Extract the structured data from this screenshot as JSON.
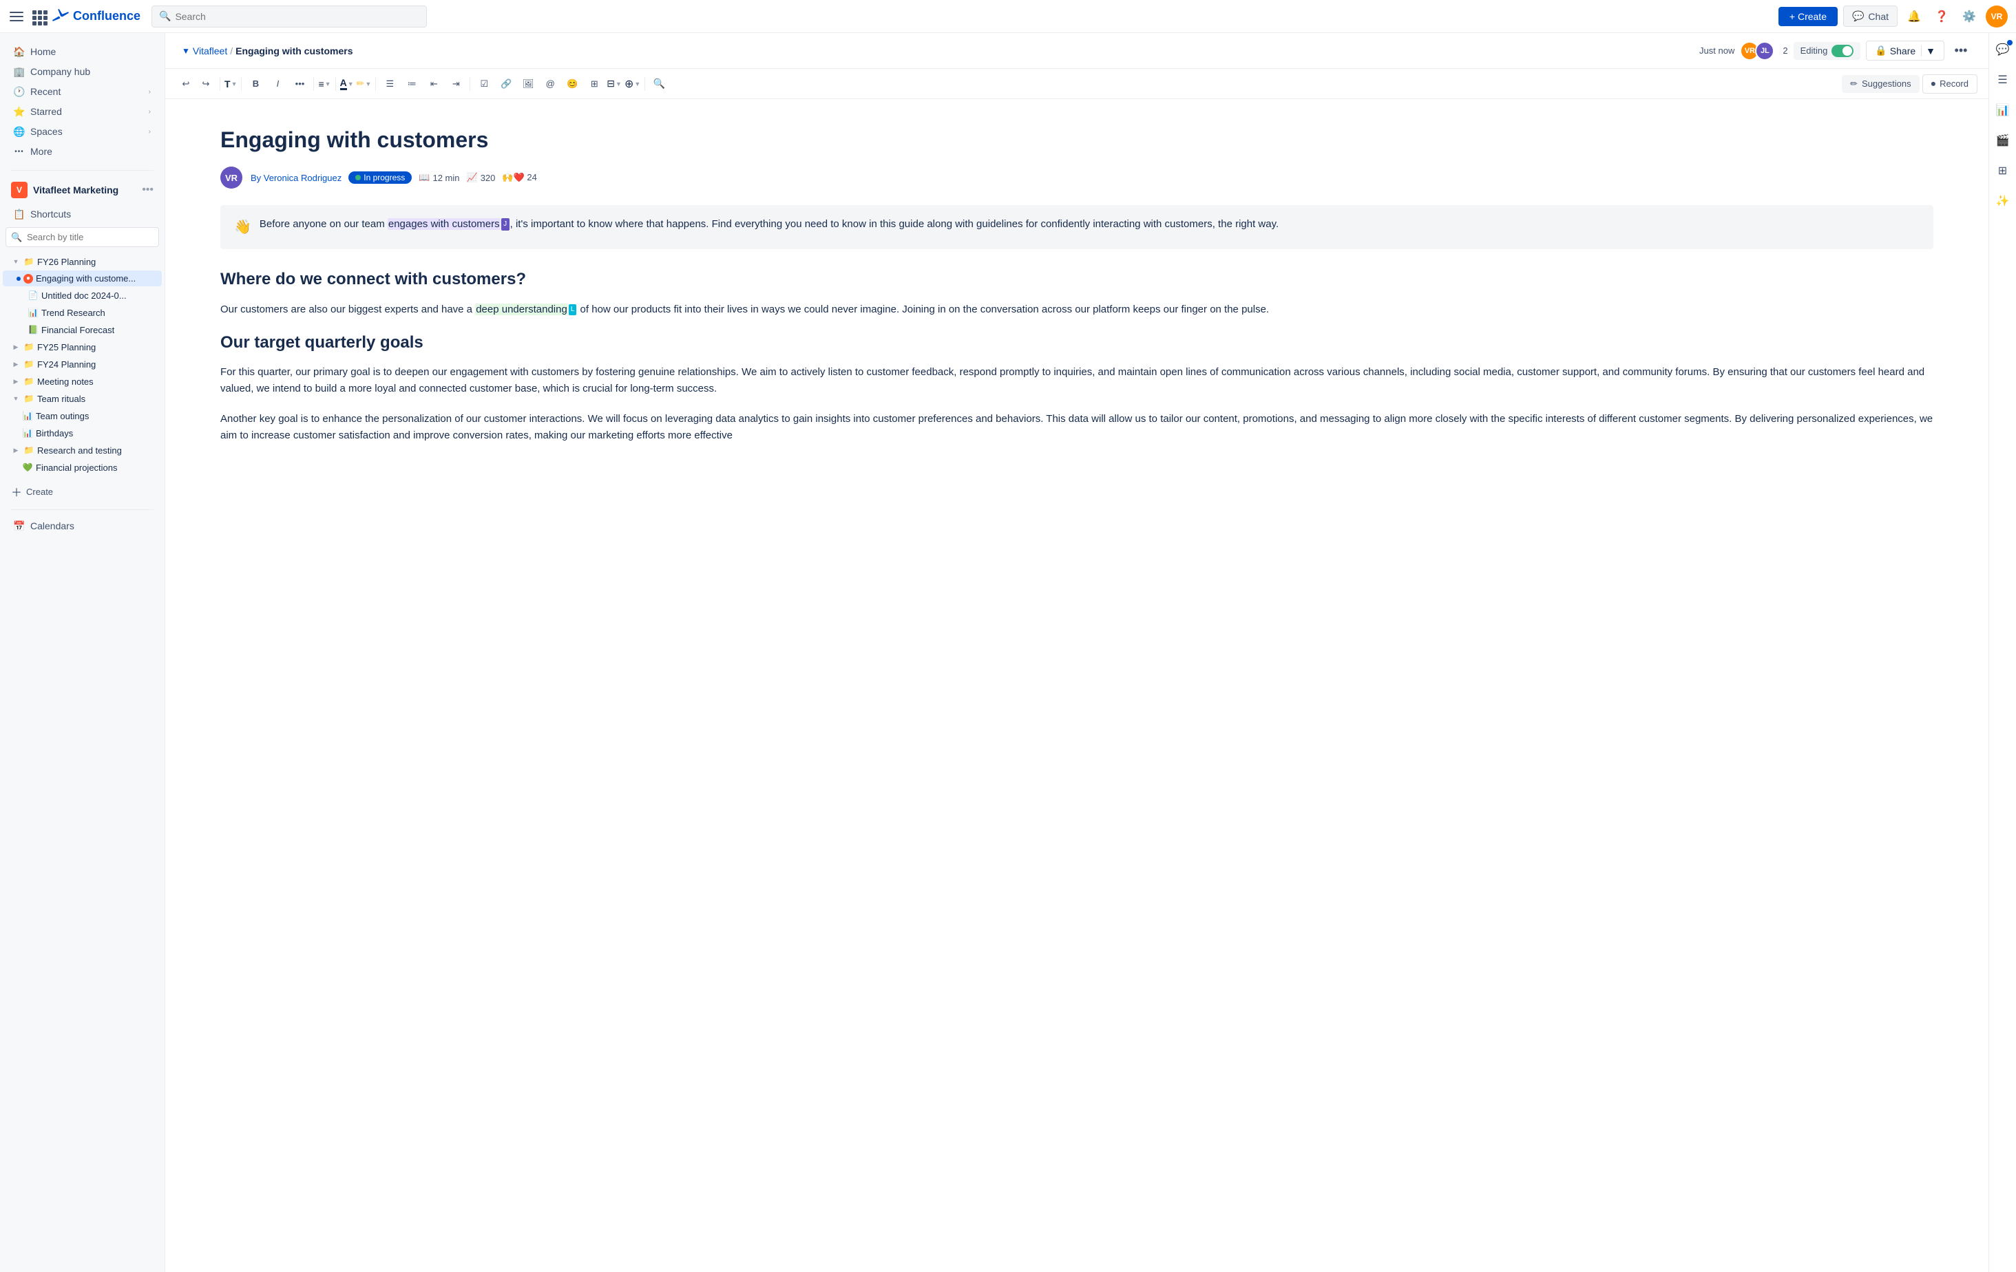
{
  "topbar": {
    "search_placeholder": "Search",
    "create_label": "+ Create",
    "chat_label": "Chat"
  },
  "doc_header": {
    "breadcrumb_space": "Vitafleet",
    "breadcrumb_sep": "/",
    "breadcrumb_current": "Engaging with customers",
    "timestamp": "Just now",
    "collab_count": "2",
    "editing_label": "Editing",
    "share_label": "Share"
  },
  "toolbar": {
    "suggestions_label": "Suggestions",
    "record_label": "Record"
  },
  "sidebar": {
    "nav_items": [
      {
        "label": "Home",
        "icon": "🏠"
      },
      {
        "label": "Company hub",
        "icon": "🏢"
      },
      {
        "label": "Recent",
        "icon": "🕐",
        "has_chevron": true
      },
      {
        "label": "Starred",
        "icon": "⭐",
        "has_chevron": true
      },
      {
        "label": "Spaces",
        "icon": "🌐",
        "has_chevron": true
      },
      {
        "label": "More",
        "icon": "···"
      }
    ],
    "space_name": "Vitafleet Marketing",
    "shortcut_label": "Shortcuts",
    "search_placeholder": "Search by title",
    "tree": [
      {
        "id": "fy26",
        "label": "FY26 Planning",
        "indent": 0,
        "icon": "📁",
        "expanded": true,
        "chevron": "▼"
      },
      {
        "id": "engaging",
        "label": "Engaging with custome...",
        "indent": 1,
        "icon": "🔴",
        "selected": true,
        "dot": true
      },
      {
        "id": "untitled",
        "label": "Untitled doc 2024-0...",
        "indent": 2,
        "icon": "📄"
      },
      {
        "id": "trend",
        "label": "Trend Research",
        "indent": 2,
        "icon": "📊"
      },
      {
        "id": "financial",
        "label": "Financial Forecast",
        "indent": 2,
        "icon": "📗"
      },
      {
        "id": "fy25",
        "label": "FY25 Planning",
        "indent": 0,
        "icon": "📁",
        "chevron": "▶"
      },
      {
        "id": "fy24",
        "label": "FY24 Planning",
        "indent": 0,
        "icon": "📁",
        "chevron": "▶"
      },
      {
        "id": "meeting",
        "label": "Meeting notes",
        "indent": 0,
        "icon": "📁",
        "chevron": "▶"
      },
      {
        "id": "team-rituals",
        "label": "Team rituals",
        "indent": 0,
        "icon": "📁",
        "expanded": true,
        "chevron": "▼"
      },
      {
        "id": "outings",
        "label": "Team outings",
        "indent": 1,
        "icon": "📊"
      },
      {
        "id": "birthdays",
        "label": "Birthdays",
        "indent": 1,
        "icon": "📊"
      },
      {
        "id": "research",
        "label": "Research and testing",
        "indent": 0,
        "icon": "📁",
        "chevron": "▶"
      },
      {
        "id": "financial-proj",
        "label": "Financial projections",
        "indent": 1,
        "icon": "💚"
      }
    ],
    "create_label": "Create",
    "calendars_label": "Calendars"
  },
  "doc": {
    "title": "Engaging with customers",
    "author": "By Veronica Rodriguez",
    "status": "In progress",
    "read_time": "12 min",
    "views": "320",
    "reactions": "🙌❤️ 24",
    "callout_icon": "👋",
    "callout_text_before": "Before anyone on our team ",
    "callout_highlight": "engages with customers",
    "callout_text_after": ", it's important to know where that happens. Find everything you need to know in this guide along with guidelines for confidently interacting with customers, the right way.",
    "cursor_j_label": "J",
    "h2_1": "Where do we connect with customers?",
    "p1_before": "Our customers are also our biggest experts and have a ",
    "p1_highlight": "deep understanding",
    "cursor_l_label": "L",
    "p1_after": " of how our products fit into their lives in ways we could never imagine. Joining in on the conversation across our platform keeps our finger on the pulse.",
    "cursor_g_label": "",
    "h2_2": "Our target quarterly goals",
    "p2": "For this quarter, our primary goal is to deepen our engagement with customers by fostering genuine relationships. We aim to actively listen to customer feedback, respond promptly to inquiries, and maintain open lines of communication across various channels, including social media, customer support, and community forums. By ensuring that our customers feel heard and valued, we intend to build a more loyal and connected customer base, which is crucial for long-term success.",
    "p3": "Another key goal is to enhance the personalization of our customer interactions. We will focus on leveraging data analytics to gain insights into customer preferences and behaviors. This data will allow us to tailor our content, promotions, and messaging to align more closely with the specific interests of different customer segments. By delivering personalized experiences, we aim to increase customer satisfaction and improve conversion rates, making our marketing efforts more effective"
  }
}
